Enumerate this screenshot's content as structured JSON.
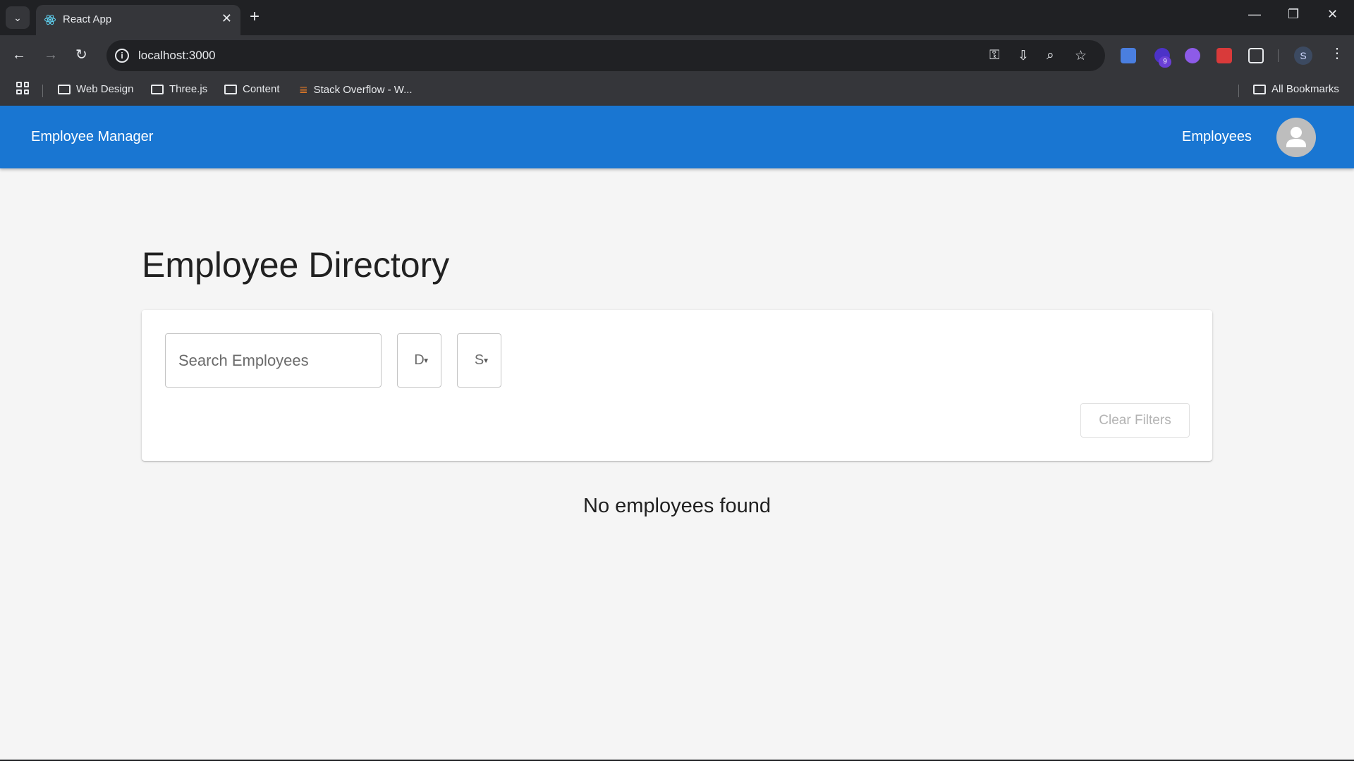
{
  "browser": {
    "tab_title": "React App",
    "url": "localhost:3000",
    "bookmarks": [
      "Web Design",
      "Three.js",
      "Content",
      "Stack Overflow - W..."
    ],
    "all_bookmarks": "All Bookmarks",
    "extension_badge": "9",
    "profile_initial": "S"
  },
  "appbar": {
    "brand": "Employee Manager",
    "nav_employees": "Employees",
    "color": "#1976d2"
  },
  "page": {
    "title": "Employee Directory",
    "search_placeholder": "Search Employees",
    "department_select": "D",
    "status_select": "S",
    "clear_filters": "Clear Filters",
    "empty_message": "No employees found"
  }
}
